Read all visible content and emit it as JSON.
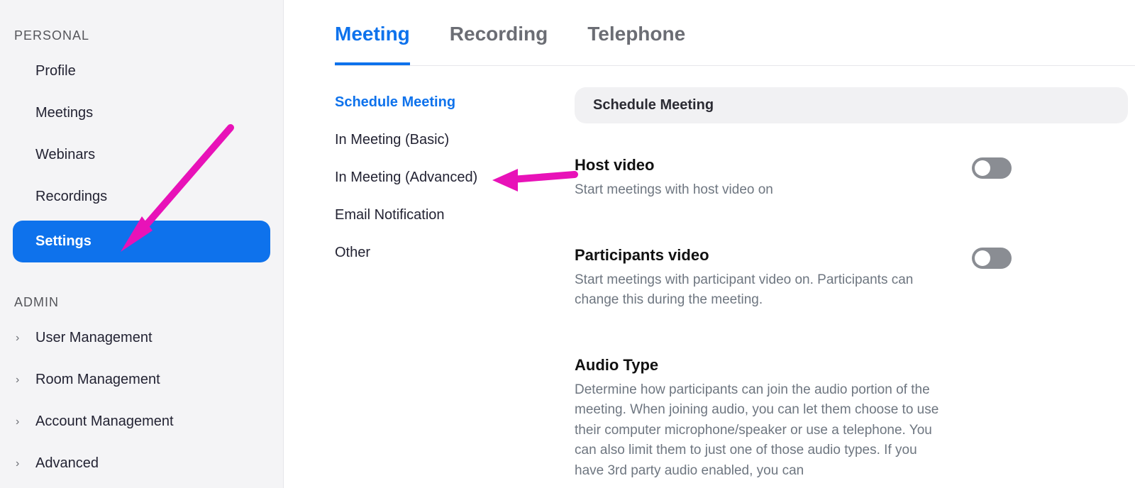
{
  "sidebar": {
    "sections": {
      "personal": {
        "label": "PERSONAL",
        "items": [
          {
            "id": "profile",
            "label": "Profile",
            "active": false
          },
          {
            "id": "meetings",
            "label": "Meetings",
            "active": false
          },
          {
            "id": "webinars",
            "label": "Webinars",
            "active": false
          },
          {
            "id": "recordings",
            "label": "Recordings",
            "active": false
          },
          {
            "id": "settings",
            "label": "Settings",
            "active": true
          }
        ]
      },
      "admin": {
        "label": "ADMIN",
        "items": [
          {
            "id": "user-management",
            "label": "User Management",
            "has_children": true
          },
          {
            "id": "room-management",
            "label": "Room Management",
            "has_children": true
          },
          {
            "id": "account-management",
            "label": "Account Management",
            "has_children": true
          },
          {
            "id": "advanced",
            "label": "Advanced",
            "has_children": true
          }
        ]
      }
    }
  },
  "tabs": [
    {
      "id": "meeting",
      "label": "Meeting",
      "active": true
    },
    {
      "id": "recording",
      "label": "Recording",
      "active": false
    },
    {
      "id": "telephone",
      "label": "Telephone",
      "active": false
    }
  ],
  "subnav": [
    {
      "id": "schedule-meeting",
      "label": "Schedule Meeting",
      "active": true
    },
    {
      "id": "in-meeting-basic",
      "label": "In Meeting (Basic)",
      "active": false
    },
    {
      "id": "in-meeting-advanced",
      "label": "In Meeting (Advanced)",
      "active": false
    },
    {
      "id": "email-notification",
      "label": "Email Notification",
      "active": false
    },
    {
      "id": "other",
      "label": "Other",
      "active": false
    }
  ],
  "section_header": "Schedule Meeting",
  "settings": [
    {
      "id": "host-video",
      "title": "Host video",
      "desc": "Start meetings with host video on",
      "toggle": false
    },
    {
      "id": "participants-video",
      "title": "Participants video",
      "desc": "Start meetings with participant video on. Participants can change this during the meeting.",
      "toggle": false
    },
    {
      "id": "audio-type",
      "title": "Audio Type",
      "desc": "Determine how participants can join the audio portion of the meeting. When joining audio, you can let them choose to use their computer microphone/speaker or use a telephone. You can also limit them to just one of those audio types. If you have 3rd party audio enabled, you can",
      "toggle": null
    }
  ],
  "annotations": {
    "arrow_color": "#e812b8"
  }
}
